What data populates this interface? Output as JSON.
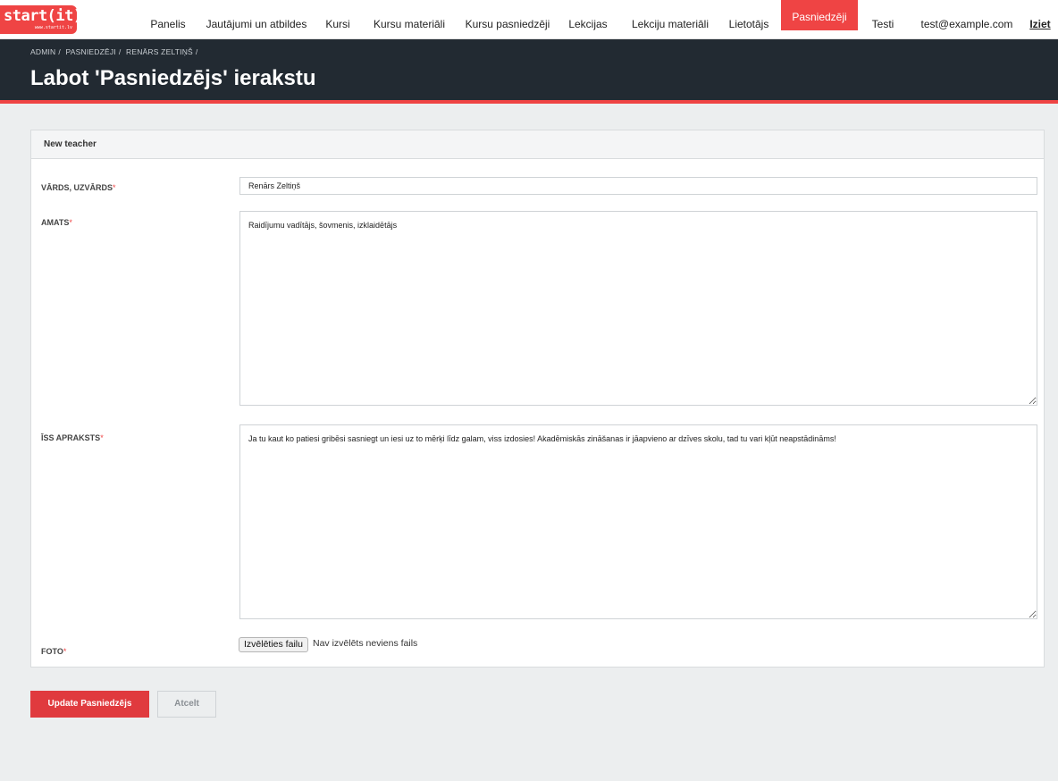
{
  "brand": {
    "logo_text": "start(it)",
    "logo_subtext": "www.startit.lv",
    "accent_color": "#ef4444",
    "header_color": "#222a32"
  },
  "nav": {
    "items": [
      {
        "label": "Panelis",
        "active": false
      },
      {
        "label": "Jautājumi un atbildes",
        "active": false
      },
      {
        "label": "Kursi",
        "active": false
      },
      {
        "label": "Kursu materiāli",
        "active": false
      },
      {
        "label": "Kursu pasniedzēji",
        "active": false
      },
      {
        "label": "Lekcijas",
        "active": false
      },
      {
        "label": "Lekciju materiāli",
        "active": false
      },
      {
        "label": "Lietotājs",
        "active": false
      },
      {
        "label": "Pasniedzēji",
        "active": true
      },
      {
        "label": "Testi",
        "active": false
      }
    ],
    "user_email": "test@example.com",
    "logout_label": "Iziet"
  },
  "header": {
    "breadcrumb": [
      "ADMIN",
      "/",
      "PASNIEDZĒJI",
      "/",
      "RENĀRS ZELTIŅŠ",
      "/"
    ],
    "title": "Labot 'Pasniedzējs' ierakstu"
  },
  "form": {
    "panel_title": "New teacher",
    "required_marker": "*",
    "name": {
      "label": "VĀRDS, UZVĀRDS",
      "value": "Renārs Zeltiņš"
    },
    "position": {
      "label": "AMATS",
      "value": "Raidījumu vadītājs, šovmenis, izklaidētājs"
    },
    "description": {
      "label": "ĪSS APRAKSTS",
      "value": "Ja tu kaut ko patiesi gribēsi sasniegt un iesi uz to mērķi līdz galam, viss izdosies! Akadēmiskās zināšanas ir jāapvieno ar dzīves skolu, tad tu vari kļūt neapstādināms!"
    },
    "photo": {
      "label": "FOTO",
      "button_label": "Izvēlēties failu",
      "status": "Nav izvēlēts neviens fails"
    }
  },
  "actions": {
    "submit_label": "Update Pasniedzējs",
    "cancel_label": "Atcelt"
  }
}
